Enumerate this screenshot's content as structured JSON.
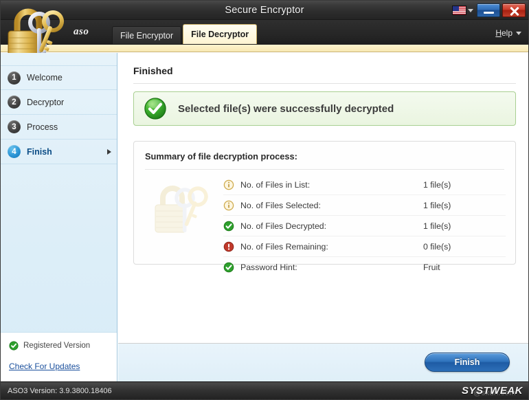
{
  "window": {
    "title": "Secure Encryptor",
    "language_flag": "us-flag-icon",
    "minimize_label": "",
    "close_label": ""
  },
  "tabbar": {
    "brand": "aso",
    "tabs": [
      {
        "label": "File Encryptor",
        "active": false
      },
      {
        "label": "File Decryptor",
        "active": true
      }
    ],
    "help_accel": "H",
    "help_rest": "elp"
  },
  "sidebar": {
    "steps": [
      {
        "num": "1",
        "label": "Welcome",
        "active": false
      },
      {
        "num": "2",
        "label": "Decryptor",
        "active": false
      },
      {
        "num": "3",
        "label": "Process",
        "active": false
      },
      {
        "num": "4",
        "label": "Finish",
        "active": true
      }
    ],
    "registered_label": "Registered Version",
    "check_updates_label": "Check For Updates"
  },
  "main": {
    "page_title": "Finished",
    "banner_text": "Selected file(s) were successfully decrypted",
    "panel_heading": "Summary of file decryption process:",
    "summary_rows": [
      {
        "icon": "info-icon",
        "label": "No. of Files in List:",
        "value": "1 file(s)"
      },
      {
        "icon": "info-icon",
        "label": "No. of Files Selected:",
        "value": "1 file(s)"
      },
      {
        "icon": "check-icon",
        "label": "No. of Files Decrypted:",
        "value": "1 file(s)"
      },
      {
        "icon": "warning-icon",
        "label": "No. of Files Remaining:",
        "value": "0 file(s)"
      },
      {
        "icon": "check-icon",
        "label": "Password Hint:",
        "value": "Fruit"
      }
    ]
  },
  "footer": {
    "finish_label": "Finish"
  },
  "statusbar": {
    "version_text": "ASO3 Version: 3.9.3800.18406",
    "brand": "SYSTWEAK",
    "watermark": "@sxdn.com"
  },
  "colors": {
    "accent_blue": "#1e5ba4",
    "active_tab": "#fdf4d2",
    "success_green": "#2ea02e",
    "warning_red": "#c0392b",
    "info_tan": "#d8b65a",
    "sidebar_bg": "#ddeef8",
    "titlebar_bg": "#2e2e2e"
  }
}
